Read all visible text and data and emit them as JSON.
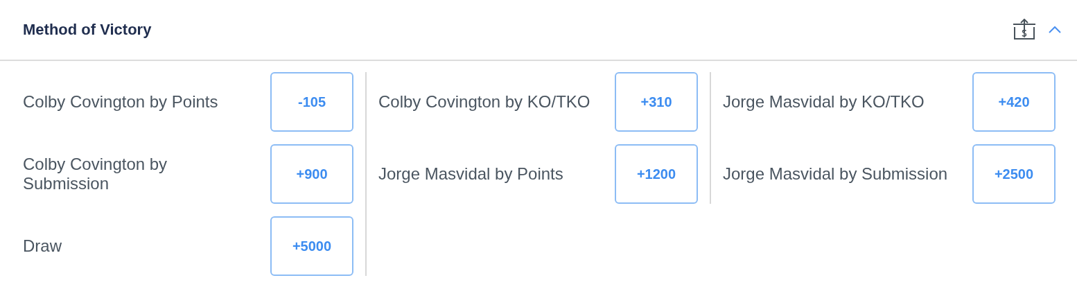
{
  "header": {
    "title": "Method of Victory",
    "expanded": true
  },
  "columns": [
    {
      "options": [
        {
          "label": "Colby Covington by Points",
          "odds": "-105"
        },
        {
          "label": "Colby Covington by Submission",
          "odds": "+900"
        },
        {
          "label": "Draw",
          "odds": "+5000"
        }
      ]
    },
    {
      "options": [
        {
          "label": "Colby Covington by KO/TKO",
          "odds": "+310"
        },
        {
          "label": "Jorge Masvidal by Points",
          "odds": "+1200"
        }
      ]
    },
    {
      "options": [
        {
          "label": "Jorge Masvidal by KO/TKO",
          "odds": "+420"
        },
        {
          "label": "Jorge Masvidal by Submission",
          "odds": "+2500"
        }
      ]
    }
  ]
}
